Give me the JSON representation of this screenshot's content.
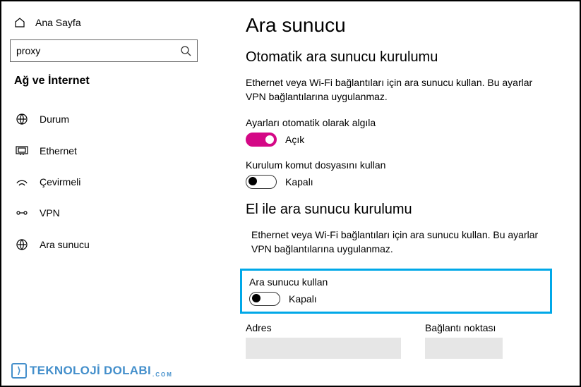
{
  "sidebar": {
    "home_label": "Ana Sayfa",
    "search_value": "proxy",
    "category_heading": "Ağ ve İnternet",
    "items": [
      {
        "label": "Durum",
        "icon": "status-icon"
      },
      {
        "label": "Ethernet",
        "icon": "ethernet-icon"
      },
      {
        "label": "Çevirmeli",
        "icon": "dialup-icon"
      },
      {
        "label": "VPN",
        "icon": "vpn-icon"
      },
      {
        "label": "Ara sunucu",
        "icon": "proxy-icon"
      }
    ]
  },
  "main": {
    "page_title": "Ara sunucu",
    "section1": {
      "heading": "Otomatik ara sunucu kurulumu",
      "description": "Ethernet veya Wi-Fi bağlantıları için ara sunucu kullan. Bu ayarlar VPN bağlantılarına uygulanmaz.",
      "auto_detect": {
        "label": "Ayarları otomatik olarak algıla",
        "state_text": "Açık",
        "on": true
      },
      "setup_script": {
        "label": "Kurulum komut dosyasını kullan",
        "state_text": "Kapalı",
        "on": false
      }
    },
    "section2": {
      "heading": "El ile ara sunucu kurulumu",
      "description": "Ethernet veya Wi-Fi bağlantıları için ara sunucu kullan. Bu ayarlar VPN bağlantılarına uygulanmaz.",
      "use_proxy": {
        "label": "Ara sunucu kullan",
        "state_text": "Kapalı",
        "on": false
      },
      "address_label": "Adres",
      "port_label": "Bağlantı noktası"
    }
  },
  "watermark": {
    "brand": "TEKNOLOJİ DOLABI",
    "sub": ".COM"
  }
}
